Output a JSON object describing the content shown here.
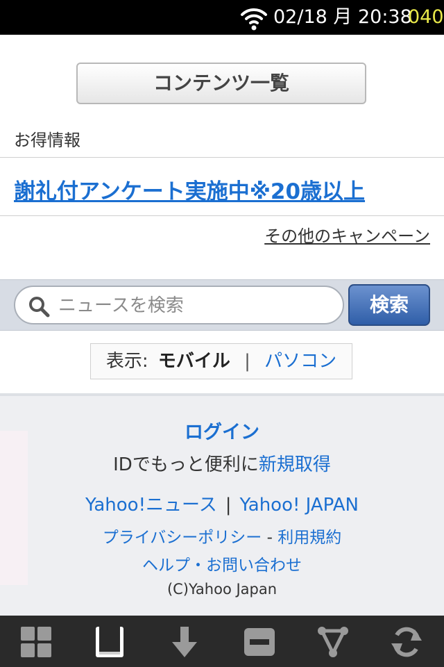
{
  "status_bar": {
    "time": "02/18 月 20:38",
    "battery": "040",
    "icons": [
      "wifi-icon"
    ]
  },
  "content": {
    "contents_button": "コンテンツ一覧",
    "section_label": "お得情報",
    "campaign_link": "謝礼付アンケート実施中※20歳以上",
    "other_campaigns": "その他のキャンペーン"
  },
  "search": {
    "placeholder": "ニュースを検索",
    "button": "検索"
  },
  "display_mode": {
    "label": "表示:",
    "current": "モバイル",
    "separator": "|",
    "alternative": "パソコン"
  },
  "footer": {
    "login": "ログイン",
    "id_text": "IDでもっと便利に",
    "register": "新規取得",
    "yahoo_news": "Yahoo!ニュース",
    "separator": "|",
    "yahoo_japan": "Yahoo! JAPAN",
    "privacy": "プライバシーポリシー",
    "dash": " - ",
    "terms": "利用規約",
    "help": "ヘルプ・お問い合わせ",
    "copyright": "(C)Yahoo Japan"
  },
  "toolbar": {
    "icons": [
      "grid-icon",
      "bookmark-icon",
      "download-icon",
      "minimize-icon",
      "share-icon",
      "refresh-icon"
    ]
  },
  "colors": {
    "link": "#1b6fd1",
    "battery": "#e8e84a",
    "search_button": "#2f5ea8"
  }
}
